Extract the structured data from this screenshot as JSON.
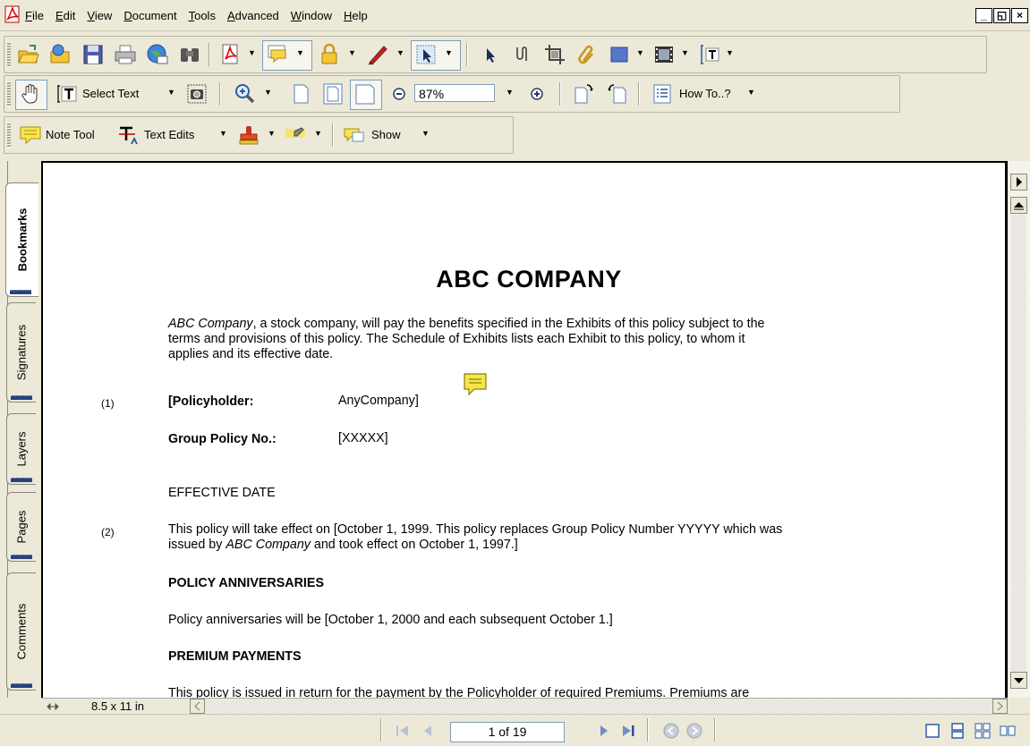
{
  "menubar": {
    "items": [
      "File",
      "Edit",
      "View",
      "Document",
      "Tools",
      "Advanced",
      "Window",
      "Help"
    ],
    "mnemonics": [
      "F",
      "E",
      "V",
      "D",
      "T",
      "A",
      "W",
      "H"
    ],
    "window_controls": [
      "_",
      "🗗",
      "×"
    ]
  },
  "toolbar_nav": {
    "select_text_label": "Select Text",
    "zoom_value": "87%",
    "howto_label": "How To..?"
  },
  "toolbar_comment": {
    "note_tool_label": "Note Tool",
    "text_edits_label": "Text Edits",
    "show_label": "Show"
  },
  "navpanel": {
    "tabs": [
      "Bookmarks",
      "Signatures",
      "Layers",
      "Pages",
      "Comments"
    ]
  },
  "document": {
    "title": "ABC COMPANY",
    "intro_company": "ABC Company",
    "intro_rest_line1": ", a stock company, will pay the benefits specified in the Exhibits of this policy subject to the",
    "intro_line2": "terms and provisions of this policy.  The Schedule of Exhibits lists each Exhibit to this policy, to whom it",
    "intro_line3": "applies and its effective date.",
    "item1_num": "(1)",
    "policyholder_label": "[Policyholder:",
    "policyholder_value": "AnyCompany]",
    "group_policy_label": "Group Policy No.:",
    "group_policy_value": "[XXXXX]",
    "effective_heading": "EFFECTIVE DATE",
    "item2_num": "(2)",
    "effective_line1": "This policy will take effect on [October 1, 1999.  This policy replaces Group Policy Number YYYYY which was",
    "effective_line2_pre": "issued by ",
    "effective_line2_company": "ABC Company",
    "effective_line2_post": " and took effect on October 1, 1997.]",
    "anniv_heading": "POLICY ANNIVERSARIES",
    "anniv_text": "Policy anniversaries will be [October 1, 2000 and each subsequent October 1.]",
    "premium_heading": "PREMIUM PAYMENTS",
    "premium_cut_text": "This policy is issued in return for the payment by the Policyholder of required Premiums.  Premiums are"
  },
  "hbar": {
    "page_size": "8.5 x 11 in"
  },
  "statusbar": {
    "page_indicator": "1 of 19"
  }
}
